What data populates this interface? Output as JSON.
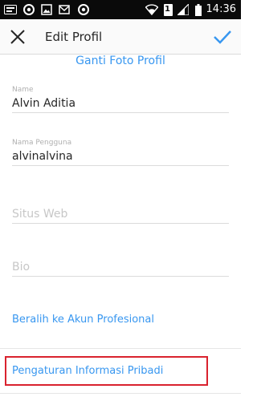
{
  "status_bar": {
    "time": "14:36",
    "sim_number": "1",
    "icons": [
      "messenger-icon",
      "chrome-icon",
      "gallery-icon",
      "gmail-icon",
      "chrome-icon",
      "wifi-icon",
      "sim-icon",
      "signal-icon",
      "battery-icon"
    ]
  },
  "toolbar": {
    "title": "Edit Profil",
    "close_icon": "close-icon",
    "done_icon": "checkmark-icon"
  },
  "profile": {
    "change_photo_label": "Ganti Foto Profil",
    "fields": {
      "name": {
        "label": "Name",
        "value": "Alvin Aditia"
      },
      "username": {
        "label": "Nama Pengguna",
        "value": "alvinalvina"
      },
      "website": {
        "placeholder": "Situs Web",
        "value": ""
      },
      "bio": {
        "placeholder": "Bio",
        "value": ""
      }
    },
    "switch_professional_label": "Beralih ke Akun Profesional",
    "personal_info_label": "Pengaturan Informasi Pribadi"
  },
  "colors": {
    "accent": "#3897f0",
    "highlight": "#d9222e",
    "status_bar": "#0a0a0a"
  }
}
